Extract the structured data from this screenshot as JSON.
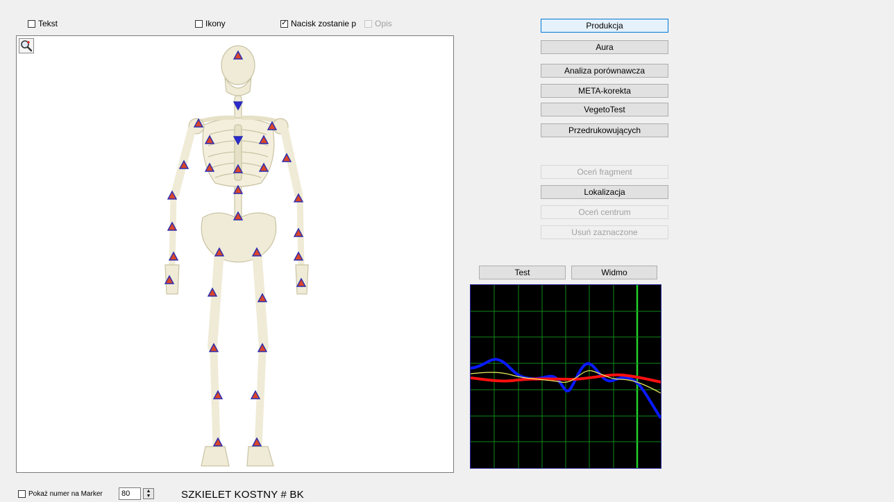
{
  "top_options": {
    "tekst": {
      "label": "Tekst",
      "checked": false
    },
    "ikony": {
      "label": "Ikony",
      "checked": false
    },
    "nacisk": {
      "label": "Nacisk zostanie p",
      "checked": true
    },
    "opis": {
      "label": "Opis",
      "checked": false,
      "disabled": true
    }
  },
  "buttons": {
    "produkcja": "Produkcja",
    "aura": "Aura",
    "analiza": "Analiza porównawcza",
    "meta": "META-korekta",
    "vegeto": "VegetoTest",
    "przedruk": "Przedrukowujących",
    "ocen_fragment": "Oceń fragment",
    "lokalizacja": "Lokalizacja",
    "ocen_centrum": "Oceń centrum",
    "usun": "Usuń zaznaczone",
    "test": "Test",
    "widmo": "Widmo"
  },
  "bottom": {
    "pokaz_label": "Pokaż numer na Marker",
    "pokaz_checked": false,
    "marker_number": "80",
    "title": "SZKIELET KOSTNY # BK"
  },
  "colors": {
    "marker_fill": "#d9462a",
    "marker_stroke": "#2b2bb0",
    "marker_down_fill": "#2b2bd0",
    "bone": "#efebd6",
    "graph_grid": "#0f8a1a",
    "graph_highlight": "#22d22a",
    "wave_blue": "#0a1aff",
    "wave_red": "#ff1010",
    "wave_yellow": "#f0f060"
  },
  "icons": {
    "zoom": "magnifier-plus-icon"
  }
}
